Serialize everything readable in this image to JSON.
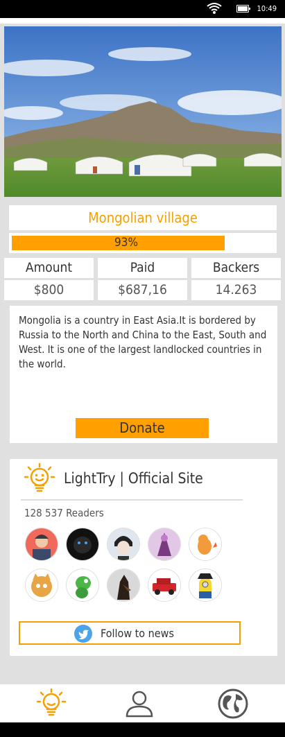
{
  "status_bar": {
    "time": "10:49"
  },
  "hero": {
    "image": "Mongolian yurts on a green steppe with mountains"
  },
  "project": {
    "title": "Mongolian village",
    "progress_percent": 93,
    "progress_label": "93%"
  },
  "stats": {
    "labels": [
      "Amount",
      "Paid",
      "Backers"
    ],
    "values": [
      "$800",
      "$687,16",
      "14.263"
    ]
  },
  "description": {
    "text": "Mongolia is a country in East Asia.It is bordered by Russia to the North and China to the East, South and West. It is one of the largest landlocked countries in the world.",
    "donate_label": "Donate"
  },
  "site": {
    "name": "LightTry | Official Site",
    "readers": "128 537 Readers",
    "follow_label": "Follow to news",
    "avatars": [
      "man-avatar",
      "black-panther-avatar",
      "anime-boy-avatar",
      "warrior-avatar",
      "charmander-avatar",
      "cat-avatar",
      "lizard-avatar",
      "dog-avatar",
      "red-car-avatar",
      "minion-avatar"
    ]
  },
  "tabs": [
    "lightbulb-tab",
    "profile-tab",
    "globe-tab"
  ],
  "colors": {
    "accent": "#ffa000",
    "title": "#f5a000",
    "twitter": "#4ca3e8"
  }
}
